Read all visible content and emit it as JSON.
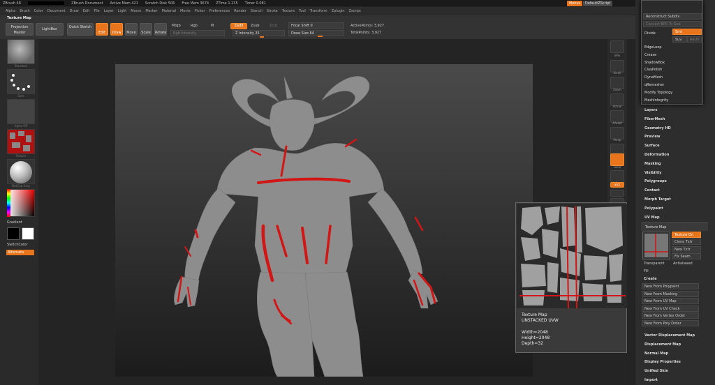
{
  "titlebar": {
    "app": "ZBrush 4R",
    "doc": "ZBrush Document",
    "active_mem": "Active Mem 421",
    "scratch": "Scratch Disk 506",
    "free_mem": "Free Mem 3674",
    "ztime": "ZTime 1.235",
    "timer": "Timer 0.081"
  },
  "menubar": {
    "items": [
      "Alpha",
      "Brush",
      "Color",
      "Document",
      "Draw",
      "Edit",
      "File",
      "Layer",
      "Light",
      "Macro",
      "Marker",
      "Material",
      "Movie",
      "Picker",
      "Preferences",
      "Render",
      "Stencil",
      "Stroke",
      "Texture",
      "Tool",
      "Transform",
      "Zplugin",
      "Zscript"
    ],
    "menus_btn": "Menus",
    "script_btn": "DefaultZScript"
  },
  "toolbar": {
    "palette_title": "Texture Map",
    "projection_master": "Projection Master",
    "lightbox": "LightBox",
    "quick_sketch": "Quick Sketch",
    "edit": "Edit",
    "draw": "Draw",
    "move": "Move",
    "scale": "Scale",
    "rotate": "Rotate",
    "mrgb": "Mrgb",
    "rgb": "Rgb",
    "m": "M",
    "rgb_intensity": "Rgb Intensity",
    "zadd": "Zadd",
    "zsub": "Zsub",
    "zcut": "Zcut",
    "z_intensity": "Z Intensity 25",
    "focal_shift": "Focal Shift 0",
    "draw_size": "Draw Size 64",
    "active_points": "ActivePoints: 3,927",
    "total_points": "TotalPoints: 3,927"
  },
  "leftshelf": {
    "brush_label": "Standard",
    "stroke_label": "Dots",
    "alpha_label": "Alpha Off",
    "texture_label": "Texture",
    "material_label": "MatCap Gray",
    "gradient": "Gradient",
    "switch_color": "SwitchColor",
    "alternate": "Alternate"
  },
  "rightshelf": {
    "spix": "SPix",
    "scroll": "Scroll",
    "zoom": "Zoom",
    "actual": "Actual",
    "aahalf": "AAHalf",
    "persp": "Persp",
    "floor": "Floor",
    "local": "Local",
    "lsym": "L.Sym",
    "xyz": "XYZ",
    "solo": "Solo",
    "xpose": "Xpose"
  },
  "popup": {
    "top": "Reconstruct Subdiv",
    "convert": "Convert BPR To Geo",
    "divide": "Divide",
    "smt": "Smt",
    "suv": "Suv",
    "rsuv": "ReUV",
    "items": [
      "EdgeLoop",
      "Crease",
      "ShadowBox",
      "ClayPolish",
      "DynaMesh",
      "qRemesher",
      "Modify Topology",
      "MeshIntegrity"
    ]
  },
  "rightpal": {
    "sections": [
      "Layers",
      "FiberMesh",
      "Geometry HD",
      "Preview",
      "Surface",
      "Deformation",
      "Masking",
      "Visibility",
      "Polygroups",
      "Contact",
      "Morph Target",
      "Polypaint",
      "UV Map"
    ],
    "texture_map_title": "Texture Map",
    "texture_on": "Texture On",
    "clone_txtr": "Clone Txtr",
    "new_txtr": "New Txtr",
    "fix_seam": "Fix Seam",
    "transparent": "Transparent",
    "antialiased": "Antialiased",
    "fill": "Fill",
    "create": "Create",
    "create_items": [
      "New From Polypaint",
      "New From Masking",
      "New From UV Map",
      "New From UV Check",
      "New From Vertex Order",
      "New From Poly Order"
    ],
    "bottom_sections": [
      "Vector Displacement Map",
      "Displacement Map",
      "Normal Map",
      "Display Properties",
      "Unified Skin",
      "Import"
    ]
  },
  "texmap_popup": {
    "title": "Texture Map",
    "subtitle": "UNSTACKED UVW",
    "width": "Width=2048",
    "height": "Height=2048",
    "depth": "Depth=32"
  },
  "colors": {
    "accent": "#e8741c",
    "mesh": "#8d8d8d",
    "paint": "#d21515"
  }
}
